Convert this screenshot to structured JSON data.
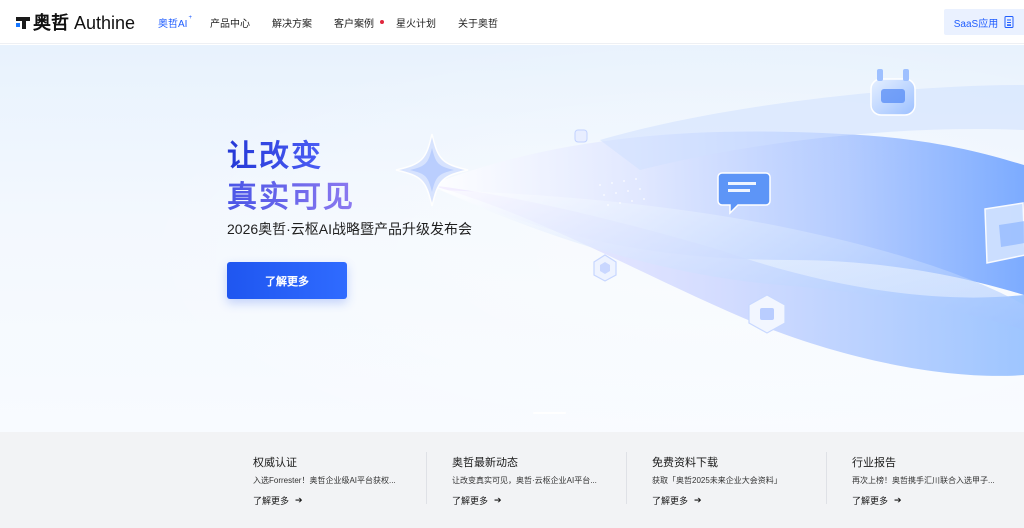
{
  "brand": {
    "logo_cn": "奥哲",
    "logo_en": "Authine"
  },
  "nav": {
    "items": [
      {
        "label": "奥哲AI",
        "sup": "+"
      },
      {
        "label": "产品中心"
      },
      {
        "label": "解决方案"
      },
      {
        "label": "客户案例"
      },
      {
        "label": "星火计划"
      },
      {
        "label": "关于奥哲"
      }
    ],
    "saas_label": "SaaS应用"
  },
  "hero": {
    "title_line1": "让改变",
    "title_line2": "真实可见",
    "subtitle": "2026奥哲·云枢AI战略暨产品升级发布会",
    "cta_label": "了解更多"
  },
  "cards": [
    {
      "title": "权威认证",
      "desc": "入选Forrester！奥哲企业级AI平台获权...",
      "link": "了解更多"
    },
    {
      "title": "奥哲最新动态",
      "desc": "让改变真实可见，奥哲·云枢企业AI平台...",
      "link": "了解更多"
    },
    {
      "title": "免费资料下载",
      "desc": "获取「奥哲2025未来企业大会资料」",
      "link": "了解更多"
    },
    {
      "title": "行业报告",
      "desc": "再次上榜！奥哲携手汇川联合入选甲子...",
      "link": "了解更多"
    }
  ],
  "colors": {
    "brand_blue": "#1f5dff",
    "nav_dot": "#e0263d",
    "strip_bg": "#f2f3f5"
  },
  "icons": [
    "logo-mark-icon",
    "document-icon",
    "arrow-right-icon"
  ]
}
